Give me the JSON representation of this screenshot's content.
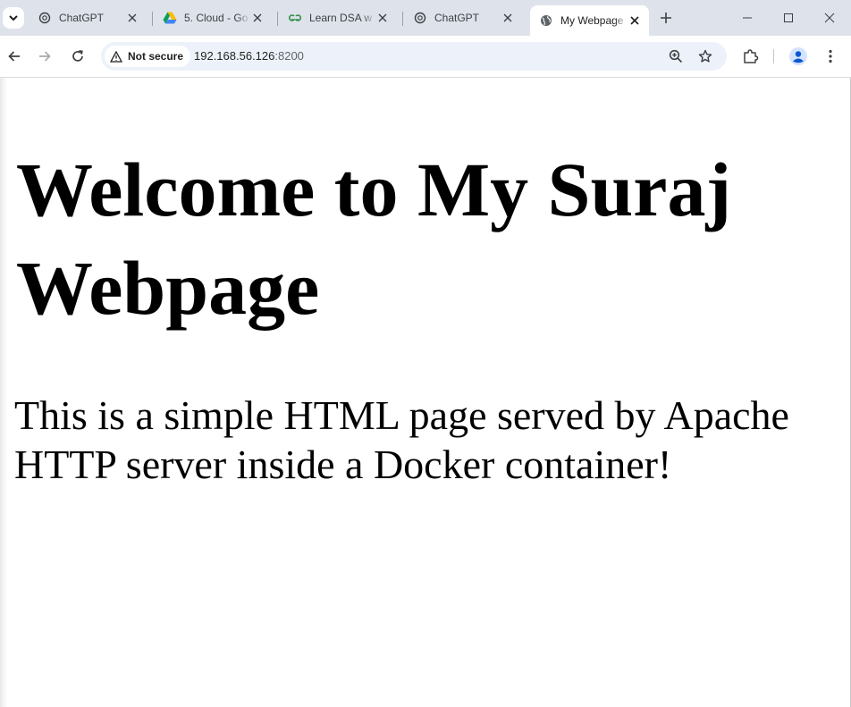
{
  "browser": {
    "tabs": [
      {
        "title": "ChatGPT",
        "icon": "chatgpt-icon",
        "active": false
      },
      {
        "title": "5. Cloud - Go",
        "icon": "google-drive-icon",
        "active": false
      },
      {
        "title": "Learn DSA w",
        "icon": "geeksforgeeks-icon",
        "active": false
      },
      {
        "title": "ChatGPT",
        "icon": "chatgpt-icon",
        "active": false
      },
      {
        "title": "My Webpage",
        "icon": "globe-icon",
        "active": true
      }
    ],
    "security_label": "Not secure",
    "url_host": "192.168.56.126",
    "url_port": ":8200"
  },
  "page": {
    "heading": "Welcome to My Suraj Webpage",
    "paragraph": "This is a simple HTML page served by Apache HTTP server inside a Docker container!"
  },
  "colors": {
    "tabstrip": "#dee3eb",
    "omnibox": "#edf2fa",
    "avatar": "#0b57d0"
  }
}
